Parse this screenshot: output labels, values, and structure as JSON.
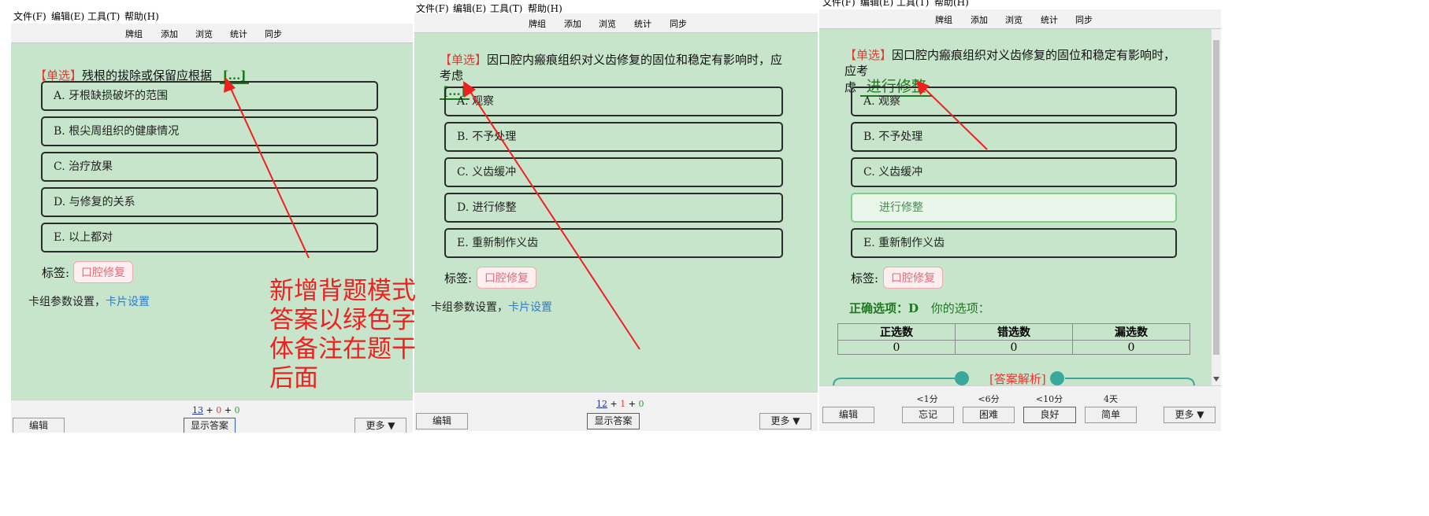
{
  "menu": [
    "文件(F)",
    "编辑(E)",
    "工具(T)",
    "帮助(H)"
  ],
  "nav": [
    "牌组",
    "添加",
    "浏览",
    "统计",
    "同步"
  ],
  "panel1": {
    "tag": "【单选】",
    "question": "残根的拔除或保留应根据",
    "blank": "[...]",
    "options": [
      "A. 牙根缺损破坏的范围",
      "B. 根尖周组织的健康情况",
      "C. 治疗放果",
      "D. 与修复的关系",
      "E. 以上都对"
    ],
    "tag_label": "标签:",
    "tag_value": "口腔修复",
    "settings_text": "卡组参数设置，",
    "settings_link": "卡片设置",
    "counts": {
      "new": "13",
      "learn": "0",
      "due": "0",
      "plus": "+"
    },
    "edit": "编辑",
    "show_answer": "显示答案",
    "more": "更多 ▼"
  },
  "annotation": [
    "新增背题模式",
    "答案以绿色字",
    "体备注在题干",
    "后面"
  ],
  "panel2": {
    "tag": "【单选】",
    "question": "因口腔内瘢痕组织对义齿修复的固位和稳定有影响时，应考虑",
    "blank": "[...]",
    "options": [
      "A. 观察",
      "B. 不予处理",
      "C. 义齿缓冲",
      "D. 进行修整",
      "E. 重新制作义齿"
    ],
    "tag_label": "标签:",
    "tag_value": "口腔修复",
    "settings_text": "卡组参数设置，",
    "settings_link": "卡片设置",
    "counts": {
      "new": "12",
      "learn": "1",
      "due": "0",
      "plus": "+"
    },
    "edit": "编辑",
    "show_answer": "显示答案",
    "more": "更多 ▼"
  },
  "panel3": {
    "tag": "【单选】",
    "question_line1": "因口腔内瘢痕组织对义齿修复的固位和稳定有影响时，应考",
    "question_line2": "虑",
    "answer_fill": "进行修整",
    "options": [
      "A. 观察",
      "B. 不予处理",
      "C. 义齿缓冲",
      "进行修整",
      "E. 重新制作义齿"
    ],
    "tag_label": "标签:",
    "tag_value": "口腔修复",
    "correct_text": "正确选项：D",
    "your_choice": "你的选项：",
    "stats_headers": [
      "正选数",
      "错选数",
      "漏选数"
    ],
    "stats_values": [
      "0",
      "0",
      "0"
    ],
    "analysis": "[答案解析]",
    "timers": [
      "<1分",
      "<6分",
      "<10分",
      "4天"
    ],
    "buttons": [
      "忘记",
      "困难",
      "良好",
      "简单"
    ],
    "edit": "编辑",
    "more": "更多 ▼"
  },
  "colors": {
    "card_bg": "#c7e5cb",
    "annotation": "#f02020",
    "answer_green": "#1e7a1e",
    "tag_red": "#e53935"
  }
}
